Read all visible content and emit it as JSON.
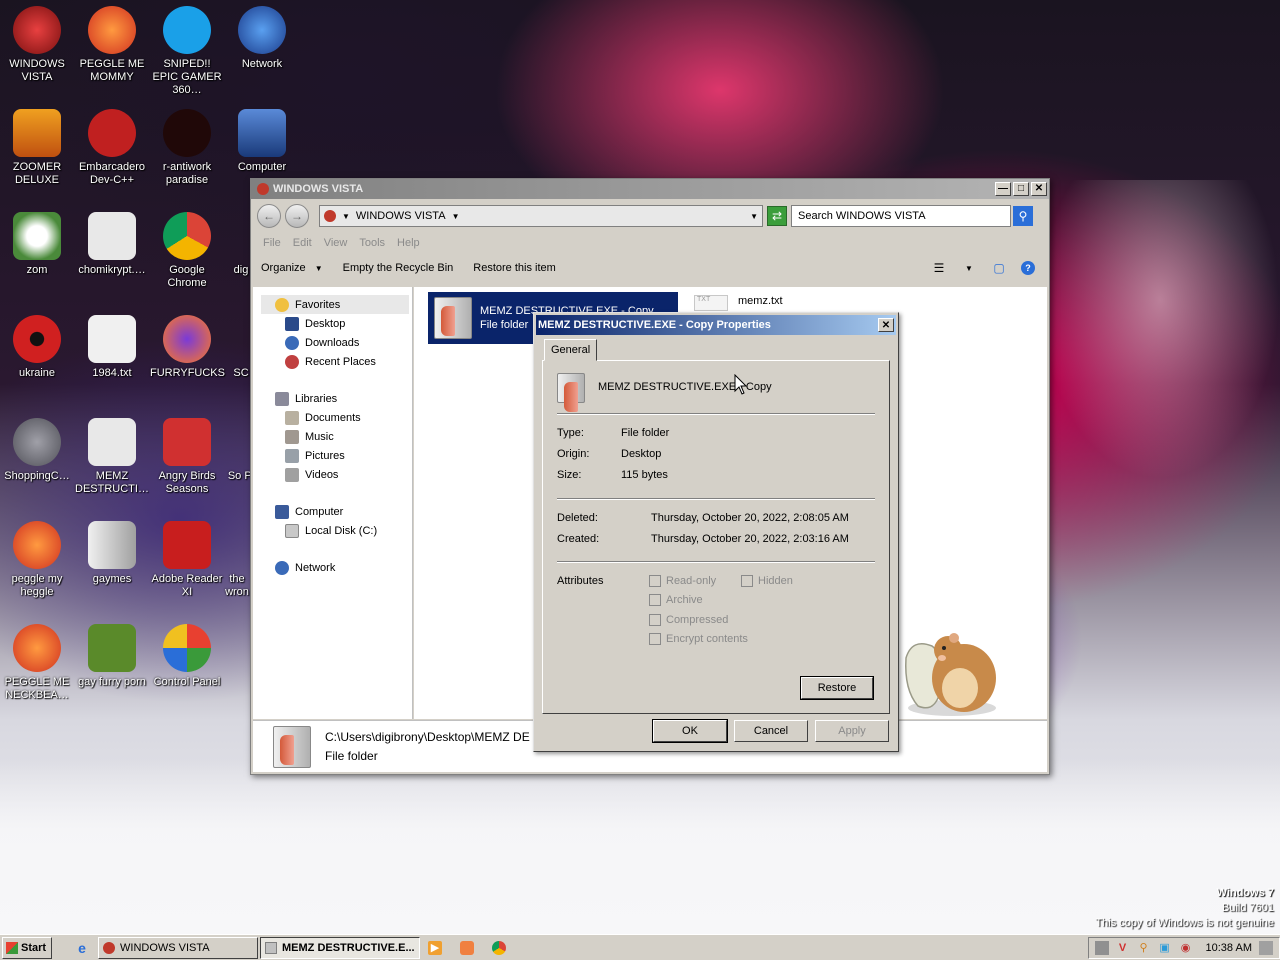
{
  "desktop": {
    "icons": [
      {
        "label": "WINDOWS VISTA",
        "icon": "vista-orb-icon"
      },
      {
        "label": "PEGGLE ME MOMMY",
        "icon": "peggle-icon"
      },
      {
        "label": "SNIPED!! EPIC GAMER 360…",
        "icon": "skype-icon"
      },
      {
        "label": "Network",
        "icon": "network-icon"
      },
      {
        "label": "ZOOMER DELUXE",
        "icon": "zoomer-icon"
      },
      {
        "label": "Embarcadero Dev-C++",
        "icon": "devcpp-icon"
      },
      {
        "label": "r-antiwork paradise",
        "icon": "antiwork-icon"
      },
      {
        "label": "Computer",
        "icon": "computer-icon"
      },
      {
        "label": "zom",
        "icon": "flower-icon"
      },
      {
        "label": "chomikrypt.…",
        "icon": "clock-file-icon"
      },
      {
        "label": "Google Chrome",
        "icon": "chrome-icon"
      },
      {
        "label": "ukraine",
        "icon": "radiation-icon"
      },
      {
        "label": "1984.txt",
        "icon": "text-file-icon"
      },
      {
        "label": "FURRYFUCKS",
        "icon": "firefox-icon"
      },
      {
        "label": "ShoppingC…",
        "icon": "flash-icon"
      },
      {
        "label": "MEMZ DESTRUCTI…",
        "icon": "clock-file-icon"
      },
      {
        "label": "Angry Birds Seasons",
        "icon": "angry-birds-icon"
      },
      {
        "label": "peggle my heggle",
        "icon": "peggle-icon"
      },
      {
        "label": "gaymes",
        "icon": "folder-icon"
      },
      {
        "label": "Adobe Reader XI",
        "icon": "acrobat-icon"
      },
      {
        "label": "PEGGLE ME NECKBEA…",
        "icon": "peggle-icon"
      },
      {
        "label": "gay furry porn",
        "icon": "box-game-icon"
      },
      {
        "label": "Control Panel",
        "icon": "control-panel-icon"
      }
    ],
    "partial_labels": [
      "dig",
      "SC",
      "So Pl",
      "the wron"
    ]
  },
  "explorer": {
    "title": "WINDOWS VISTA",
    "address": "WINDOWS VISTA",
    "search_placeholder": "Search WINDOWS VISTA",
    "menu": [
      "File",
      "Edit",
      "View",
      "Tools",
      "Help"
    ],
    "commands": {
      "organize": "Organize",
      "empty": "Empty the Recycle Bin",
      "restore": "Restore this item"
    },
    "nav": {
      "favorites": "Favorites",
      "favorites_items": [
        "Desktop",
        "Downloads",
        "Recent Places"
      ],
      "libraries": "Libraries",
      "libraries_items": [
        "Documents",
        "Music",
        "Pictures",
        "Videos"
      ],
      "computer": "Computer",
      "computer_items": [
        "Local Disk (C:)"
      ],
      "network": "Network"
    },
    "items": {
      "selected_name": "MEMZ DESTRUCTIVE.EXE - Copy",
      "selected_type": "File folder",
      "txt_name": "memz.txt",
      "txt_ext": "TXT"
    },
    "details": {
      "path": "C:\\Users\\digibrony\\Desktop\\MEMZ DE",
      "type": "File folder"
    }
  },
  "properties": {
    "title": "MEMZ DESTRUCTIVE.EXE - Copy Properties",
    "tab": "General",
    "name": "MEMZ DESTRUCTIVE.EXE - Copy",
    "type_label": "Type:",
    "type_value": "File folder",
    "origin_label": "Origin:",
    "origin_value": "Desktop",
    "size_label": "Size:",
    "size_value": "115 bytes",
    "deleted_label": "Deleted:",
    "deleted_value": "Thursday, October 20, 2022, 2:08:05 AM",
    "created_label": "Created:",
    "created_value": "Thursday, October 20, 2022, 2:03:16 AM",
    "attributes_label": "Attributes",
    "attr_readonly": "Read-only",
    "attr_hidden": "Hidden",
    "attr_archive": "Archive",
    "attr_compressed": "Compressed",
    "attr_encrypt": "Encrypt contents",
    "restore_btn": "Restore",
    "ok_btn": "OK",
    "cancel_btn": "Cancel",
    "apply_btn": "Apply"
  },
  "watermark": {
    "title": "Windows 7",
    "build": "Build 7601",
    "notice": "This copy of Windows is not genuine"
  },
  "taskbar": {
    "start": "Start",
    "task1": "WINDOWS VISTA",
    "task2": "MEMZ DESTRUCTIVE.E...",
    "clock": "10:38 AM"
  },
  "colors": {
    "selection": "#0a246a",
    "dialog_title": "#0a246a",
    "inactive_title": "#808080",
    "face": "#d4d0c8"
  }
}
